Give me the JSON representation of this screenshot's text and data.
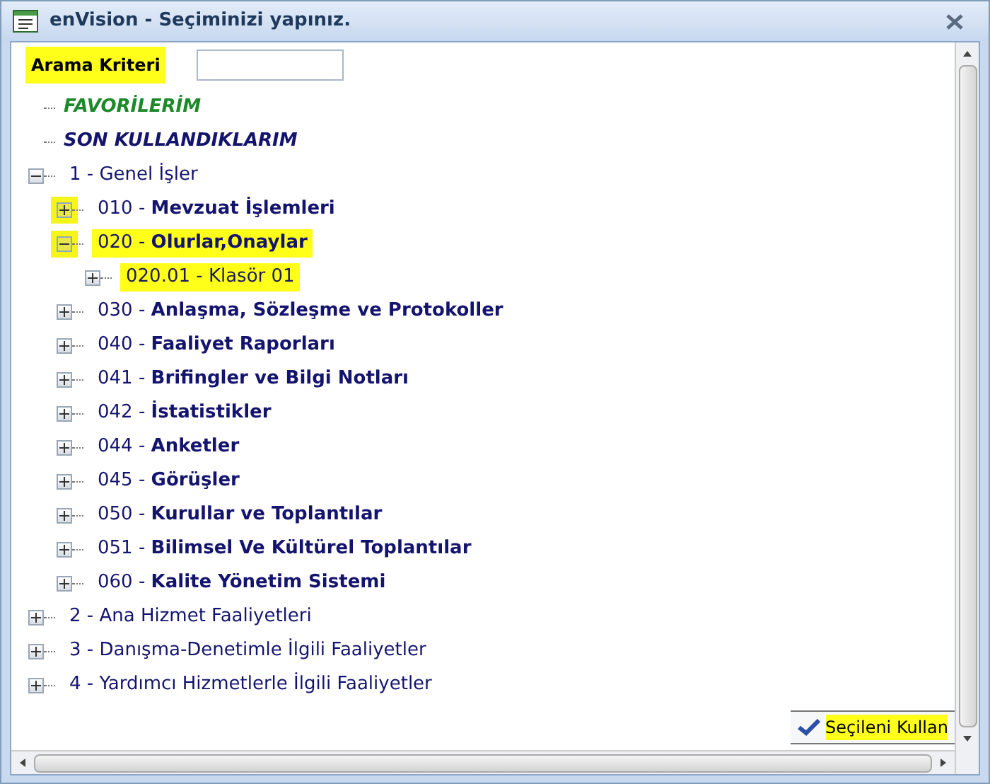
{
  "window": {
    "title": "enVision - Seçiminizi yapınız."
  },
  "search": {
    "label": "Arama Kriteri",
    "highlighted": true
  },
  "tree": [
    {
      "kind": "favorites",
      "label": "FAVORİLERİM"
    },
    {
      "kind": "recent",
      "label": "SON KULLANDIKLARIM"
    },
    {
      "kind": "node",
      "label": "1 - Genel İşler",
      "expanded": true,
      "highlighted": false,
      "toggle_highlighted": false,
      "children": [
        {
          "kind": "node",
          "label": "010 - **Mevzuat İşlemleri**",
          "expanded": false,
          "highlighted": false,
          "toggle_highlighted": true
        },
        {
          "kind": "node",
          "label": "020 - **Olurlar,Onaylar**",
          "expanded": true,
          "highlighted": true,
          "toggle_highlighted": true,
          "children": [
            {
              "kind": "node",
              "label": "020.01 - Klasör 01",
              "expanded": false,
              "highlighted": true,
              "toggle_highlighted": false
            }
          ]
        },
        {
          "kind": "node",
          "label": "030 - **Anlaşma, Sözleşme ve Protokoller**",
          "expanded": false,
          "highlighted": false,
          "toggle_highlighted": false
        },
        {
          "kind": "node",
          "label": "040 - **Faaliyet Raporları**",
          "expanded": false,
          "highlighted": false,
          "toggle_highlighted": false
        },
        {
          "kind": "node",
          "label": "041 - **Brifingler ve Bilgi Notları**",
          "expanded": false,
          "highlighted": false,
          "toggle_highlighted": false
        },
        {
          "kind": "node",
          "label": "042 - **İstatistikler**",
          "expanded": false,
          "highlighted": false,
          "toggle_highlighted": false
        },
        {
          "kind": "node",
          "label": "044 - **Anketler**",
          "expanded": false,
          "highlighted": false,
          "toggle_highlighted": false
        },
        {
          "kind": "node",
          "label": "045 - **Görüşler**",
          "expanded": false,
          "highlighted": false,
          "toggle_highlighted": false
        },
        {
          "kind": "node",
          "label": "050 - **Kurullar ve Toplantılar**",
          "expanded": false,
          "highlighted": false,
          "toggle_highlighted": false
        },
        {
          "kind": "node",
          "label": "051 - **Bilimsel Ve Kültürel Toplantılar**",
          "expanded": false,
          "highlighted": false,
          "toggle_highlighted": false
        },
        {
          "kind": "node",
          "label": "060 - **Kalite Yönetim Sistemi**",
          "expanded": false,
          "highlighted": false,
          "toggle_highlighted": false
        }
      ]
    },
    {
      "kind": "node",
      "label": "2 - Ana Hizmet Faaliyetleri",
      "expanded": false,
      "highlighted": false,
      "toggle_highlighted": false
    },
    {
      "kind": "node",
      "label": "3 - Danışma-Denetimle İlgili Faaliyetler",
      "expanded": false,
      "highlighted": false,
      "toggle_highlighted": false
    },
    {
      "kind": "node",
      "label": "4 - Yardımcı Hizmetlerle İlgili Faaliyetler",
      "expanded": false,
      "highlighted": false,
      "toggle_highlighted": false
    }
  ],
  "button": {
    "label": "Seçileni Kullan",
    "highlighted": true
  }
}
